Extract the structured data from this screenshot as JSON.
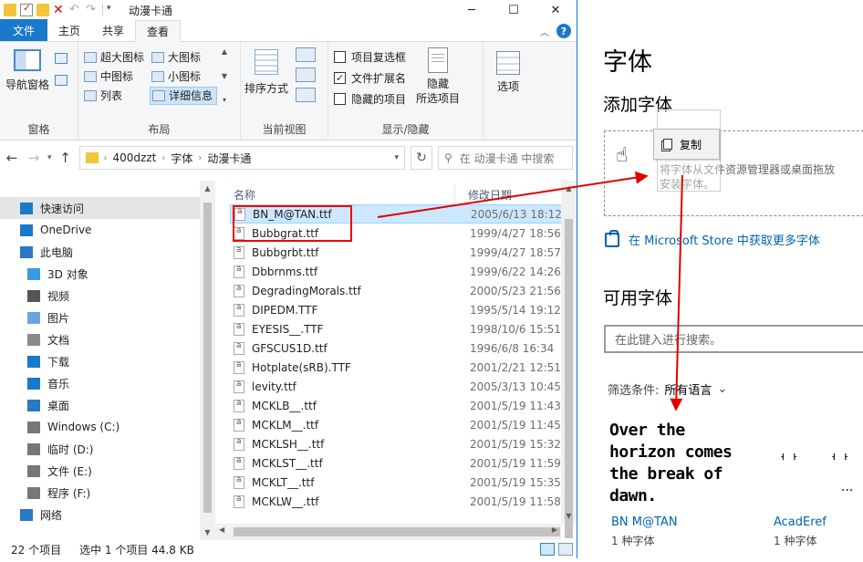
{
  "window": {
    "title": "动漫卡通",
    "controls": [
      "─",
      "☐",
      "✕"
    ]
  },
  "ribbon_tabs": [
    "文件",
    "主页",
    "共享",
    "查看"
  ],
  "ribbon": {
    "pane": {
      "nav_pane": "导航窗格",
      "label": "窗格"
    },
    "layout": {
      "items": [
        [
          "超大图标",
          "大图标"
        ],
        [
          "中图标",
          "小图标"
        ],
        [
          "列表",
          "详细信息"
        ]
      ],
      "label": "布局"
    },
    "current_view": {
      "sort": "排序方式",
      "label": "当前视图"
    },
    "show_hide": {
      "checkboxes": [
        {
          "label": "项目复选框",
          "checked": false
        },
        {
          "label": "文件扩展名",
          "checked": true
        },
        {
          "label": "隐藏的项目",
          "checked": false
        }
      ],
      "hide_line1": "隐藏",
      "hide_line2": "所选项目",
      "label": "显示/隐藏"
    },
    "options": {
      "label": "选项"
    }
  },
  "address": {
    "crumbs": [
      "400dzzt",
      "字体",
      "动漫卡通"
    ],
    "search_placeholder": "在 动漫卡通 中搜索"
  },
  "nav_pane": [
    {
      "label": "快速访问",
      "icon": "star-icon",
      "indent": 0
    },
    {
      "label": "OneDrive",
      "icon": "cloud-icon",
      "indent": 0
    },
    {
      "label": "此电脑",
      "icon": "computer-icon",
      "indent": 0
    },
    {
      "label": "3D 对象",
      "icon": "cube-icon",
      "indent": 1
    },
    {
      "label": "视频",
      "icon": "video-icon",
      "indent": 1
    },
    {
      "label": "图片",
      "icon": "picture-icon",
      "indent": 1
    },
    {
      "label": "文档",
      "icon": "document-icon",
      "indent": 1
    },
    {
      "label": "下载",
      "icon": "download-icon",
      "indent": 1
    },
    {
      "label": "音乐",
      "icon": "music-icon",
      "indent": 1
    },
    {
      "label": "桌面",
      "icon": "desktop-icon",
      "indent": 1
    },
    {
      "label": "Windows (C:)",
      "icon": "drive-icon",
      "indent": 1
    },
    {
      "label": "临时 (D:)",
      "icon": "drive-icon",
      "indent": 1
    },
    {
      "label": "文件 (E:)",
      "icon": "drive-icon",
      "indent": 1
    },
    {
      "label": "程序 (F:)",
      "icon": "drive-icon",
      "indent": 1
    },
    {
      "label": "网络",
      "icon": "network-icon",
      "indent": 0
    }
  ],
  "columns": {
    "name": "名称",
    "date": "修改日期"
  },
  "files": [
    {
      "name": "BN_M@TAN.ttf",
      "date": "2005/6/13 18:12",
      "selected": true
    },
    {
      "name": "Bubbgrat.ttf",
      "date": "1999/4/27 18:56"
    },
    {
      "name": "Bubbgrbt.ttf",
      "date": "1999/4/27 18:57"
    },
    {
      "name": "Dbbrnms.ttf",
      "date": "1999/6/22 14:26"
    },
    {
      "name": "DegradingMorals.ttf",
      "date": "2000/5/23 21:56"
    },
    {
      "name": "DIPEDM.TTF",
      "date": "1995/5/14 19:12"
    },
    {
      "name": "EYESIS__.TTF",
      "date": "1998/10/6 15:51"
    },
    {
      "name": "GFSCUS1D.ttf",
      "date": "1996/6/8 16:34"
    },
    {
      "name": "Hotplate(sRB).TTF",
      "date": "2001/2/21 12:51"
    },
    {
      "name": "levity.ttf",
      "date": "2005/3/13 10:45"
    },
    {
      "name": "MCKLB__.ttf",
      "date": "2001/5/19 11:43"
    },
    {
      "name": "MCKLM__.ttf",
      "date": "2001/5/19 11:45"
    },
    {
      "name": "MCKLSH__.ttf",
      "date": "2001/5/19 15:32"
    },
    {
      "name": "MCKLST__.ttf",
      "date": "2001/5/19 11:59"
    },
    {
      "name": "MCKLT__.ttf",
      "date": "2001/5/19 15:35"
    },
    {
      "name": "MCKLW__.ttf",
      "date": "2001/5/19 11:58"
    }
  ],
  "status": {
    "count": "22 个项目",
    "selection": "选中 1 个项目  44.8 KB"
  },
  "settings": {
    "title": "字体",
    "add_heading": "添加字体",
    "drop_text_1": "将字体从文件资源管理器或桌面拖放",
    "drop_text_2": "安装字体。",
    "store_link": "在 Microsoft Store 中获取更多字体",
    "available_heading": "可用字体",
    "search_placeholder": "在此键入进行搜索。",
    "filter_label": "筛选条件:",
    "filter_value": "所有语言",
    "card1_preview": "Over the horizon comes the break of dawn.",
    "card1_name": "BN M@TAN",
    "card1_sub": "1 种字体",
    "card2_glyphs_a": "ᅥᅡ",
    "card2_glyphs_b": "ᅥᅡ",
    "card2_glyphs_c": "...",
    "card2_name": "AcadEref",
    "card2_sub": "1 种字体"
  },
  "drag": {
    "copy_label": "复制"
  },
  "colors": {
    "accent": "#1979ca",
    "link": "#0063b1",
    "annotation": "#e00000"
  }
}
